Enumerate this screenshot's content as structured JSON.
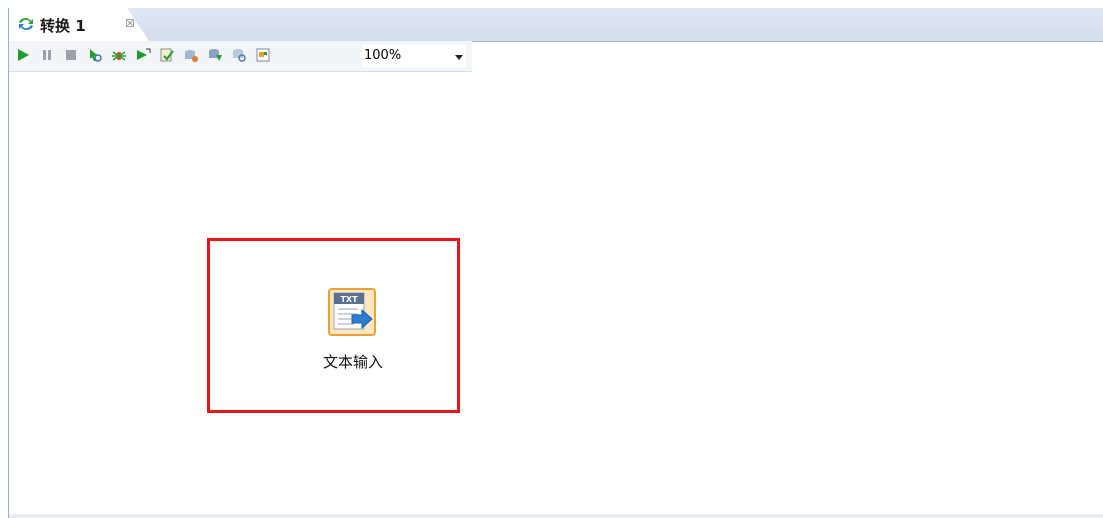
{
  "tab": {
    "title": "转换 1",
    "close_glyph": "☒",
    "icon": "transform-icon"
  },
  "toolbar": {
    "buttons": [
      {
        "name": "run-button",
        "icon": "play-icon"
      },
      {
        "name": "pause-button",
        "icon": "pause-icon"
      },
      {
        "name": "stop-button",
        "icon": "stop-icon"
      },
      {
        "name": "preview-button",
        "icon": "preview-icon"
      },
      {
        "name": "debug-button",
        "icon": "debug-icon"
      },
      {
        "name": "replay-button",
        "icon": "replay-icon"
      },
      {
        "name": "verify-button",
        "icon": "verify-icon"
      },
      {
        "name": "impact-button",
        "icon": "impact-icon"
      },
      {
        "name": "sql-button",
        "icon": "sql-icon"
      },
      {
        "name": "explore-db-button",
        "icon": "explore-db-icon"
      },
      {
        "name": "show-results-button",
        "icon": "show-results-icon"
      }
    ],
    "zoom": "100%"
  },
  "canvas": {
    "step": {
      "label": "文本输入",
      "icon": "text-file-input-icon",
      "badge": "TXT"
    },
    "highlight_color": "#e8141c"
  }
}
